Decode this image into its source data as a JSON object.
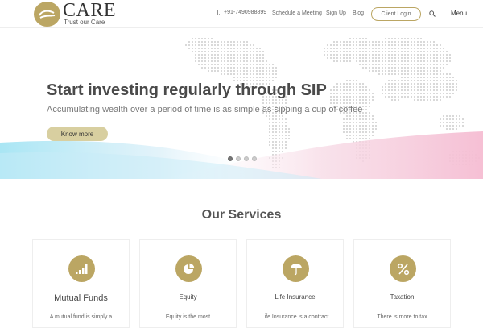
{
  "brand": {
    "name": "CARE",
    "tagline": "Trust our Care",
    "accent": "#bba663"
  },
  "nav": {
    "phone": "+91-7490988899",
    "schedule": "Schedule a Meeting",
    "signup": "Sign Up",
    "blog": "Blog",
    "client_login": "Client Login",
    "menu": "Menu"
  },
  "hero": {
    "title": "Start investing regularly through SIP",
    "subtitle": "Accumulating wealth over a period of time is as simple as sipping a cup of coffee",
    "cta": "Know more",
    "slides": 4,
    "active_slide": 1
  },
  "services": {
    "title": "Our Services",
    "cards": [
      {
        "title": "Mutual Funds",
        "text": "A mutual fund is simply a",
        "icon": "bar-chart-icon"
      },
      {
        "title": "Equity",
        "text": "Equity is the most",
        "icon": "pie-chart-icon"
      },
      {
        "title": "Life Insurance",
        "text": "Life Insurance is a contract",
        "icon": "umbrella-icon"
      },
      {
        "title": "Taxation",
        "text": "There is more to tax",
        "icon": "percent-icon"
      }
    ]
  }
}
